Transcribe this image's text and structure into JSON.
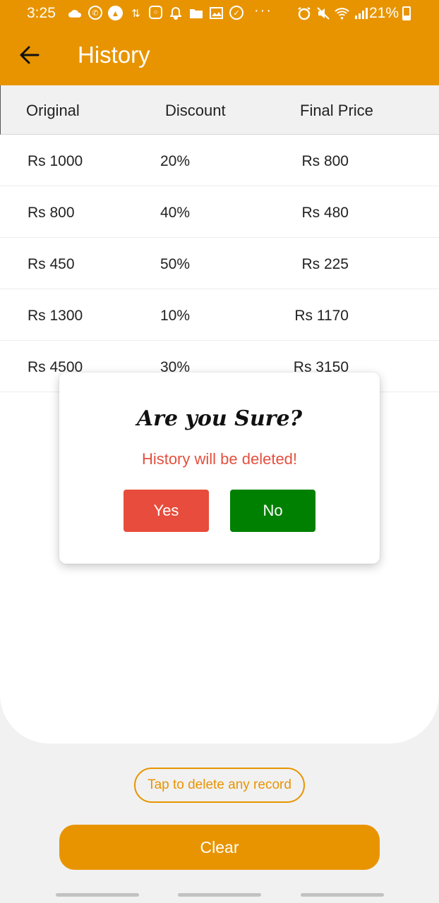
{
  "status_bar": {
    "time": "3:25",
    "battery": "21%",
    "icons_left": [
      "cloud-icon",
      "whatsapp-icon",
      "navigation-icon",
      "swap-icon",
      "instagram-icon",
      "bell-icon",
      "folder-icon",
      "image-icon",
      "check-circle-icon"
    ],
    "overflow": "···",
    "icons_right": [
      "alarm-icon",
      "mute-icon",
      "wifi-icon",
      "signal-icon"
    ]
  },
  "app_bar": {
    "title": "History",
    "back_icon": "arrow-left-icon",
    "color": "#e89400"
  },
  "table": {
    "headers": [
      "Original",
      "Discount",
      "Final Price"
    ],
    "rows": [
      {
        "original": "Rs 1000",
        "discount": "20%",
        "final": "Rs 800"
      },
      {
        "original": "Rs 800",
        "discount": "40%",
        "final": "Rs 480"
      },
      {
        "original": "Rs 450",
        "discount": "50%",
        "final": "Rs 225"
      },
      {
        "original": "Rs 1300",
        "discount": "10%",
        "final": "Rs 1170"
      },
      {
        "original": "Rs 4500",
        "discount": "30%",
        "final": "Rs 3150"
      }
    ]
  },
  "dialog": {
    "title": "Are you Sure?",
    "message": "History will be deleted!",
    "yes_label": "Yes",
    "no_label": "No",
    "yes_color": "#e74c3c",
    "no_color": "#008000"
  },
  "footer": {
    "hint_label": "Tap to delete any record",
    "clear_label": "Clear"
  }
}
